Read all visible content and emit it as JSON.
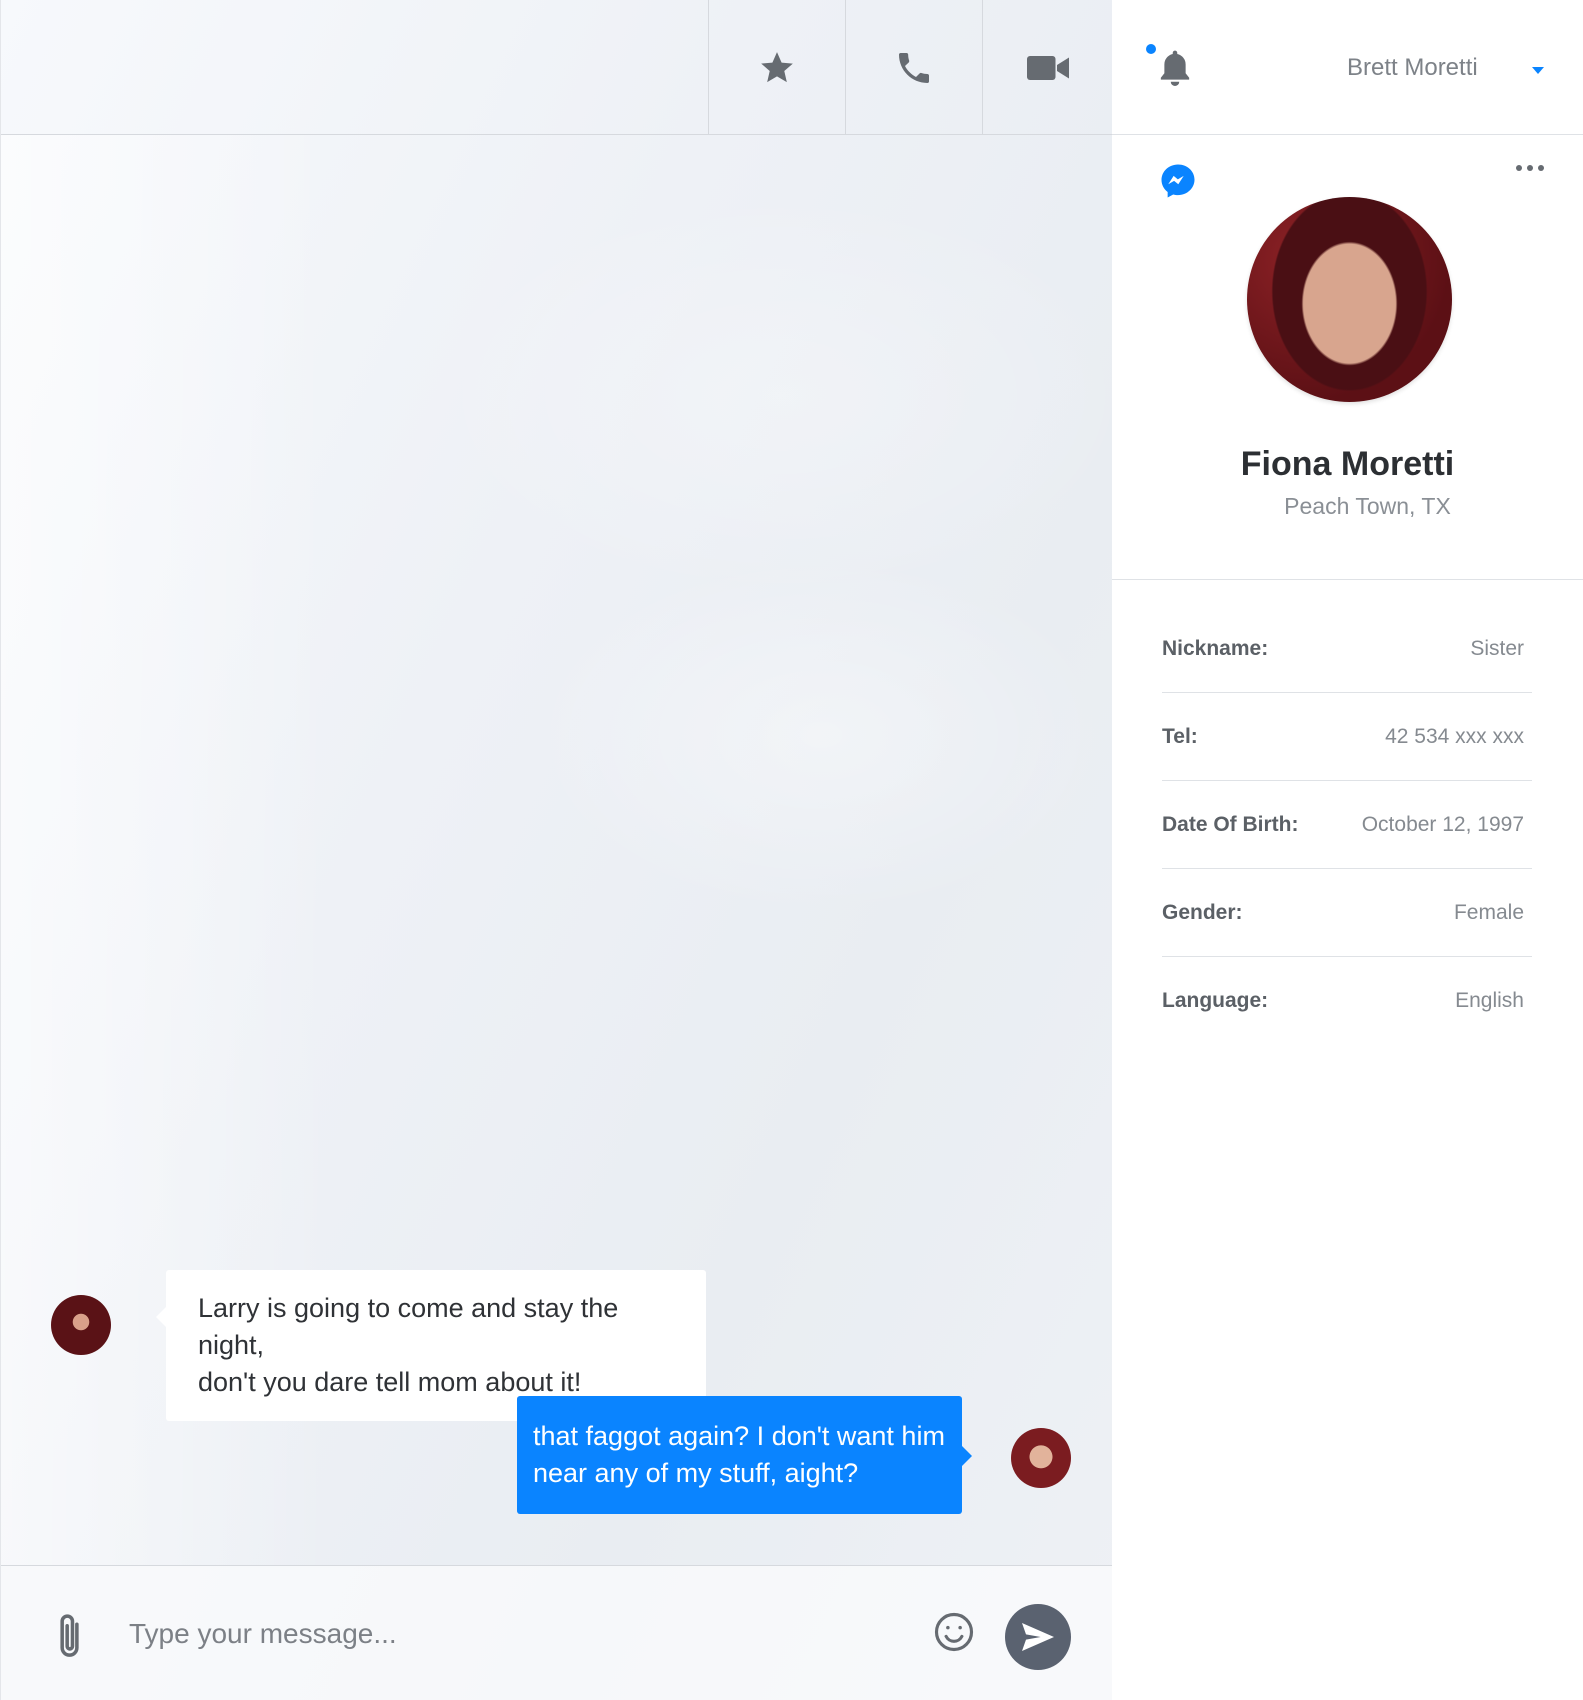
{
  "header": {
    "user_name": "Brett Moretti"
  },
  "contact": {
    "name": "Fiona Moretti",
    "location": "Peach Town, TX",
    "details": [
      {
        "label": "Nickname:",
        "value": "Sister"
      },
      {
        "label": "Tel:",
        "value": "42 534 xxx xxx"
      },
      {
        "label": "Date Of Birth:",
        "value": "October 12, 1997"
      },
      {
        "label": "Gender:",
        "value": "Female"
      },
      {
        "label": "Language:",
        "value": "English"
      }
    ]
  },
  "messages": [
    {
      "sender": "Fiona Moretti",
      "direction": "incoming",
      "text_lines": [
        "Larry is going to come and stay the night,",
        "don't you dare tell mom about it!"
      ]
    },
    {
      "sender": "Brett Moretti",
      "direction": "outgoing",
      "text_lines": [
        "that faggot again? I don't want him",
        "near any of my stuff, aight?"
      ]
    }
  ],
  "composer": {
    "placeholder": "Type your message..."
  },
  "colors": {
    "accent": "#0a84ff",
    "send_button": "#5a6270"
  },
  "icons": [
    "star-icon",
    "phone-icon",
    "video-camera-icon",
    "bell-icon",
    "caret-down-icon",
    "messenger-icon",
    "more-options-icon",
    "paperclip-icon",
    "emoji-icon",
    "send-icon"
  ]
}
